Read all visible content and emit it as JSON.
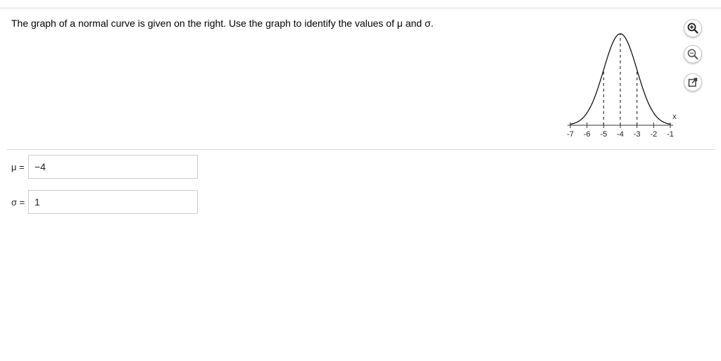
{
  "question": {
    "text": "The graph of a normal curve is given on the right. Use the graph to identify the values of μ and σ."
  },
  "graph": {
    "x_axis_label": "x",
    "tick_labels": [
      "-7",
      "-6",
      "-5",
      "-4",
      "-3",
      "-2",
      "-1"
    ],
    "dashed_line_at": [
      "-5",
      "-4",
      "-3"
    ]
  },
  "toolbar": {
    "buttons": [
      {
        "icon": "zoom-in-icon"
      },
      {
        "icon": "zoom-out-icon"
      },
      {
        "icon": "popout-icon"
      }
    ]
  },
  "answers": {
    "mu_label": "μ =",
    "mu_value": "−4",
    "sigma_label": "σ =",
    "sigma_value": "1"
  }
}
